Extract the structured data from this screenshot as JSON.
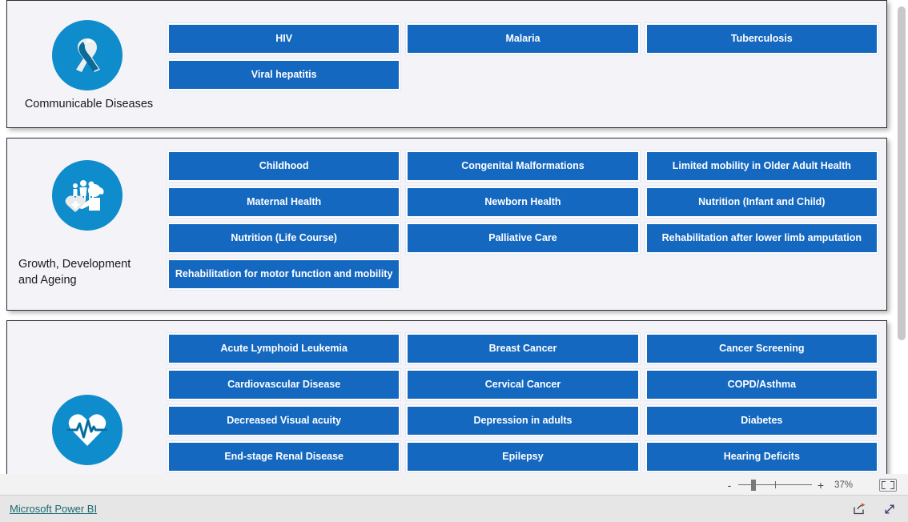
{
  "report": {
    "brand_label": "Microsoft Power BI",
    "zoom_level": "37%",
    "zoom_minus": "-",
    "zoom_plus": "+"
  },
  "sections": [
    {
      "id": "communicable",
      "label": "Communicable Diseases",
      "icon": "awareness-ribbon-icon",
      "tiles": [
        "HIV",
        "Malaria",
        "Tuberculosis",
        "Viral hepatitis"
      ]
    },
    {
      "id": "growth",
      "label": "Growth, Development and Ageing",
      "icon": "family-care-icon",
      "tiles": [
        "Childhood",
        "Congenital Malformations",
        "Limited mobility in Older Adult Health",
        "Maternal Health",
        "Newborn Health",
        "Nutrition (Infant and Child)",
        "Nutrition (Life Course)",
        "Palliative Care",
        "Rehabilitation after lower limb amputation",
        "Rehabilitation for motor function and mobility"
      ]
    },
    {
      "id": "ncd",
      "label": "",
      "icon": "heart-pulse-icon",
      "tiles": [
        "Acute Lymphoid Leukemia",
        "Breast Cancer",
        "Cancer Screening",
        "Cardiovascular Disease",
        "Cervical Cancer",
        "COPD/Asthma",
        "Decreased Visual acuity",
        "Depression in adults",
        "Diabetes",
        "End-stage Renal Disease",
        "Epilepsy",
        "Hearing Deficits"
      ]
    }
  ],
  "colors": {
    "tile_blue": "#1568c0",
    "icon_blue": "#0e8ccb",
    "panel_bg": "#f4f3f8",
    "brand_link": "#1a6a72"
  }
}
